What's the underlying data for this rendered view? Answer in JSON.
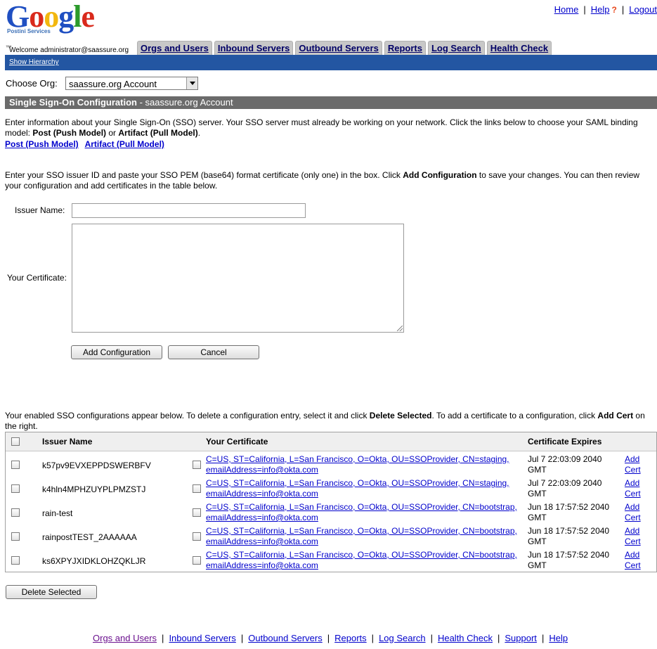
{
  "logo": {
    "word": [
      "G",
      "o",
      "o",
      "g",
      "l",
      "e"
    ],
    "colors": [
      "#1f4fc2",
      "#d92a1c",
      "#f2b70f",
      "#1f4fc2",
      "#2b9a2b",
      "#d92a1c"
    ],
    "sub": "Postini Services",
    "tm": "™"
  },
  "toplinks": {
    "home": "Home",
    "help": "Help",
    "help_icon": "?",
    "logout": "Logout",
    "sep": "|"
  },
  "welcome": "Welcome administrator@saassure.org",
  "tabs": [
    "Orgs and Users",
    "Inbound Servers",
    "Outbound Servers",
    "Reports",
    "Log Search",
    "Health Check"
  ],
  "show_hierarchy": "Show Hierarchy",
  "choose_org": {
    "label": "Choose Org:",
    "value": "saassure.org Account"
  },
  "section": {
    "title": "Single Sign-On Configuration",
    "suffix": " - saassure.org Account"
  },
  "intro": {
    "text_a": "Enter information about your Single Sign-On (SSO) server. Your SSO server must already be working on your network. Click the links below to choose your SAML binding model: ",
    "bold_a": "Post (Push Model)",
    "text_b": " or ",
    "bold_b": "Artifact (Pull Model)",
    "text_c": ".",
    "link_post": "Post (Push Model)",
    "link_artifact": "Artifact (Pull Model)"
  },
  "instructions": {
    "text_a": "Enter your SSO issuer ID and paste your SSO PEM (base64) format certificate (only one) in the box. Click ",
    "bold": "Add Configuration",
    "text_b": " to save your changes. You can then review your configuration and add certificates in the table below."
  },
  "form": {
    "issuer_label": "Issuer Name:",
    "issuer_value": "",
    "cert_label": "Your Certificate:",
    "cert_value": "",
    "add_button": "Add Configuration",
    "cancel_button": "Cancel"
  },
  "table_intro": {
    "text_a": "Your enabled SSO configurations appear below. To delete a configuration entry, select it and click ",
    "bold_a": "Delete Selected",
    "text_b": ". To add a certificate to a configuration, click ",
    "bold_b": "Add Cert",
    "text_c": " on the right."
  },
  "table": {
    "headers": {
      "issuer": "Issuer Name",
      "cert": "Your Certificate",
      "expires": "Certificate Expires"
    },
    "rows": [
      {
        "issuer": "k57pv9EVXEPPDSWERBFV",
        "cert1": "C=US, ST=California, L=San Francisco, O=Okta, OU=SSOProvider, CN=staging,",
        "cert2": "emailAddress=info@okta.com",
        "exp1": "Jul 7 22:03:09 2040",
        "exp2": "GMT",
        "add1": "Add",
        "add2": "Cert"
      },
      {
        "issuer": "k4hln4MPHZUYPLPMZSTJ",
        "cert1": "C=US, ST=California, L=San Francisco, O=Okta, OU=SSOProvider, CN=staging,",
        "cert2": "emailAddress=info@okta.com",
        "exp1": "Jul 7 22:03:09 2040",
        "exp2": "GMT",
        "add1": "Add",
        "add2": "Cert"
      },
      {
        "issuer": "rain-test",
        "cert1": "C=US, ST=California, L=San Francisco, O=Okta, OU=SSOProvider, CN=bootstrap,",
        "cert2": "emailAddress=info@okta.com",
        "exp1": "Jun 18 17:57:52 2040",
        "exp2": "GMT",
        "add1": "Add",
        "add2": "Cert"
      },
      {
        "issuer": "rainpostTEST_2AAAAAA",
        "cert1": "C=US, ST=California, L=San Francisco, O=Okta, OU=SSOProvider, CN=bootstrap,",
        "cert2": "emailAddress=info@okta.com",
        "exp1": "Jun 18 17:57:52 2040",
        "exp2": "GMT",
        "add1": "Add",
        "add2": "Cert"
      },
      {
        "issuer": "ks6XPYJXIDKLOHZQKLJR",
        "cert1": "C=US, ST=California, L=San Francisco, O=Okta, OU=SSOProvider, CN=bootstrap,",
        "cert2": "emailAddress=info@okta.com",
        "exp1": "Jun 18 17:57:52 2040",
        "exp2": "GMT",
        "add1": "Add",
        "add2": "Cert"
      }
    ]
  },
  "delete_button": "Delete Selected",
  "footer": [
    "Orgs and Users",
    "Inbound Servers",
    "Outbound Servers",
    "Reports",
    "Log Search",
    "Health Check",
    "Support",
    "Help"
  ],
  "footer_sep": "|"
}
